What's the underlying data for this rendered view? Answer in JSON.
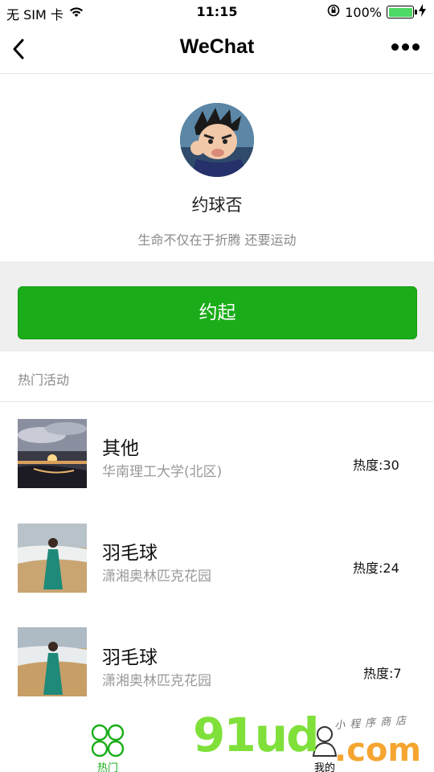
{
  "status_bar": {
    "carrier": "无 SIM 卡",
    "time": "11:15",
    "battery_text": "100%",
    "battery_level": 1.0,
    "icons": [
      "wifi-icon",
      "orientation-lock-icon",
      "battery-icon",
      "charging-icon"
    ]
  },
  "nav": {
    "title": "WeChat",
    "icons": [
      "back-icon",
      "more-icon"
    ]
  },
  "profile": {
    "name": "约球否",
    "motto": "生命不仅在于折腾 还要运动"
  },
  "main_button": {
    "label": "约起"
  },
  "section": {
    "title": "热门活动"
  },
  "activities": [
    {
      "title": "其他",
      "location": "华南理工大学(北区)",
      "heat": "热度:30"
    },
    {
      "title": "羽毛球",
      "location": "潇湘奥林匹克花园",
      "heat": "热度:24"
    },
    {
      "title": "羽毛球",
      "location": "潇湘奥林匹克花园",
      "heat": "热度:7"
    }
  ],
  "tab_bar": {
    "items": [
      {
        "label": "热门",
        "icon": "four-circles-icon",
        "active": true
      },
      {
        "label": "我的",
        "icon": "person-icon",
        "active": false
      }
    ]
  },
  "watermark": {
    "brand": "91ud",
    "domain": ".com",
    "tagline": "小程序商店"
  },
  "colors": {
    "accent": "#1aad19",
    "muted_text": "#8a8a8a",
    "band": "#efefef"
  }
}
